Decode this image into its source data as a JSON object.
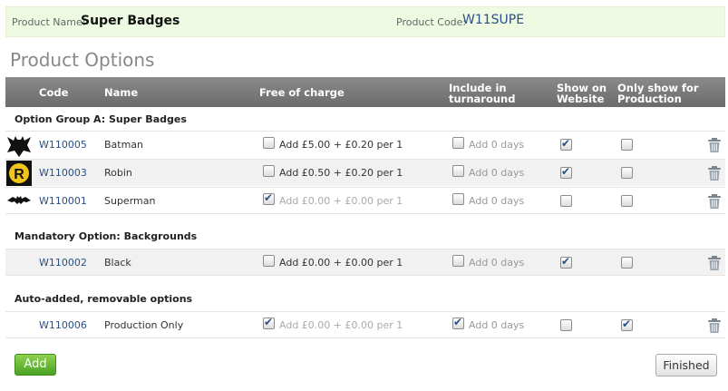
{
  "header": {
    "product_name_label": "Product Name:",
    "product_name": "Super Badges",
    "product_code_label": "Product Code:",
    "product_code": "W11SUPE"
  },
  "page_title": "Product Options",
  "table": {
    "columns": [
      "Code",
      "Name",
      "Free of charge",
      "Include in turnaround",
      "Show on Website",
      "Only show for Production"
    ],
    "groups": [
      {
        "title": "Option Group A: Super Badges",
        "rows": [
          {
            "icon": "batman-logo-icon",
            "code": "W110005",
            "name": "Batman",
            "free_checked": false,
            "price": "Add £5.00 + £0.20 per 1",
            "turn_checked": false,
            "turn_text": "Add 0 days",
            "web_checked": true,
            "prod_checked": false
          },
          {
            "icon": "robin-logo-icon",
            "code": "W110003",
            "name": "Robin",
            "free_checked": false,
            "price": "Add £0.50 + £0.20 per 1",
            "turn_checked": false,
            "turn_text": "Add 0 days",
            "web_checked": true,
            "prod_checked": false
          },
          {
            "icon": "bat-logo-icon",
            "code": "W110001",
            "name": "Superman",
            "free_checked": true,
            "price": "Add £0.00 + £0.00 per 1",
            "turn_checked": false,
            "turn_text": "Add 0 days",
            "web_checked": false,
            "prod_checked": false
          }
        ]
      },
      {
        "title": "Mandatory Option: Backgrounds",
        "rows": [
          {
            "icon": "",
            "code": "W110002",
            "name": "Black",
            "free_checked": false,
            "price": "Add £0.00 + £0.00 per 1",
            "turn_checked": false,
            "turn_text": "Add 0 days",
            "web_checked": true,
            "prod_checked": false
          }
        ]
      },
      {
        "title": "Auto-added, removable options",
        "rows": [
          {
            "icon": "",
            "code": "W110006",
            "name": "Production Only",
            "free_checked": true,
            "price": "Add £0.00 + £0.00 per 1",
            "turn_checked": true,
            "turn_text": "Add 0 days",
            "web_checked": false,
            "prod_checked": true
          }
        ]
      }
    ]
  },
  "buttons": {
    "add": "Add",
    "finished": "Finished"
  },
  "colors": {
    "header_bg": "#eefbe2",
    "link": "#2a4f86",
    "table_head": "#7a7a7a",
    "add_button": "#5cb82f"
  }
}
